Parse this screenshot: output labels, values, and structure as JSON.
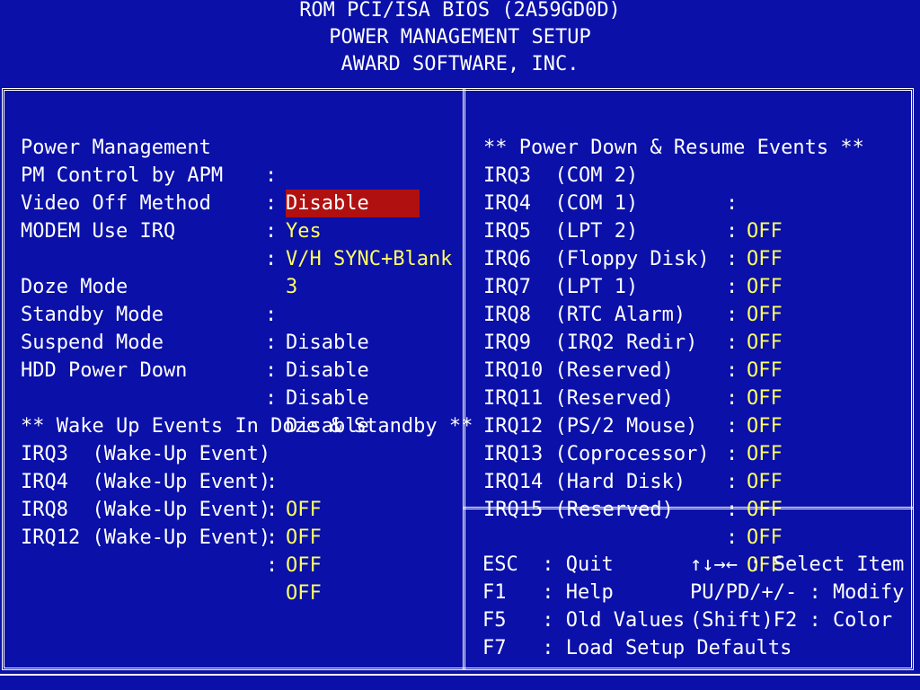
{
  "header": {
    "line1": "ROM PCI/ISA BIOS (2A59GD0D)",
    "line2": "POWER MANAGEMENT SETUP",
    "line3": "AWARD SOFTWARE, INC."
  },
  "left": {
    "settings": [
      {
        "label": "Power Management",
        "value": "Disable",
        "highlighted": true
      },
      {
        "label": "PM Control by APM",
        "value": "Yes"
      },
      {
        "label": "Video Off Method",
        "value": "V/H SYNC+Blank"
      },
      {
        "label": "MODEM Use IRQ",
        "value": "3"
      }
    ],
    "timers": [
      {
        "label": "Doze Mode",
        "value": "Disable"
      },
      {
        "label": "Standby Mode",
        "value": "Disable"
      },
      {
        "label": "Suspend Mode",
        "value": "Disable"
      },
      {
        "label": "HDD Power Down",
        "value": "Disable"
      }
    ],
    "wake_title": "** Wake Up Events In Doze & Standby **",
    "wake_events": [
      {
        "label": "IRQ3  (Wake-Up Event)",
        "value": "OFF"
      },
      {
        "label": "IRQ4  (Wake-Up Event)",
        "value": "OFF"
      },
      {
        "label": "IRQ8  (Wake-Up Event)",
        "value": "OFF"
      },
      {
        "label": "IRQ12 (Wake-Up Event)",
        "value": "OFF"
      }
    ]
  },
  "right": {
    "title": "** Power Down & Resume Events **",
    "irqs": [
      {
        "label": "IRQ3  (COM 2)",
        "value": "OFF"
      },
      {
        "label": "IRQ4  (COM 1)",
        "value": "OFF"
      },
      {
        "label": "IRQ5  (LPT 2)",
        "value": "OFF"
      },
      {
        "label": "IRQ6  (Floppy Disk)",
        "value": "OFF"
      },
      {
        "label": "IRQ7  (LPT 1)",
        "value": "OFF"
      },
      {
        "label": "IRQ8  (RTC Alarm)",
        "value": "OFF"
      },
      {
        "label": "IRQ9  (IRQ2 Redir)",
        "value": "OFF"
      },
      {
        "label": "IRQ10 (Reserved)",
        "value": "OFF"
      },
      {
        "label": "IRQ11 (Reserved)",
        "value": "OFF"
      },
      {
        "label": "IRQ12 (PS/2 Mouse)",
        "value": "OFF"
      },
      {
        "label": "IRQ13 (Coprocessor)",
        "value": "OFF"
      },
      {
        "label": "IRQ14 (Hard Disk)",
        "value": "OFF"
      },
      {
        "label": "IRQ15 (Reserved)",
        "value": "OFF"
      }
    ]
  },
  "help": {
    "esc": "ESC  : Quit",
    "f1": "F1   : Help",
    "f5": "F5   : Old Values",
    "f7": "F7   : Load Setup Defaults",
    "select": "↑↓→← : Select Item",
    "modify": "PU/PD/+/- : Modify",
    "color": "(Shift)F2 : Color"
  },
  "colors": {
    "background": "#0a10a8",
    "value_text": "#ffff60",
    "highlight": "#b01010"
  }
}
